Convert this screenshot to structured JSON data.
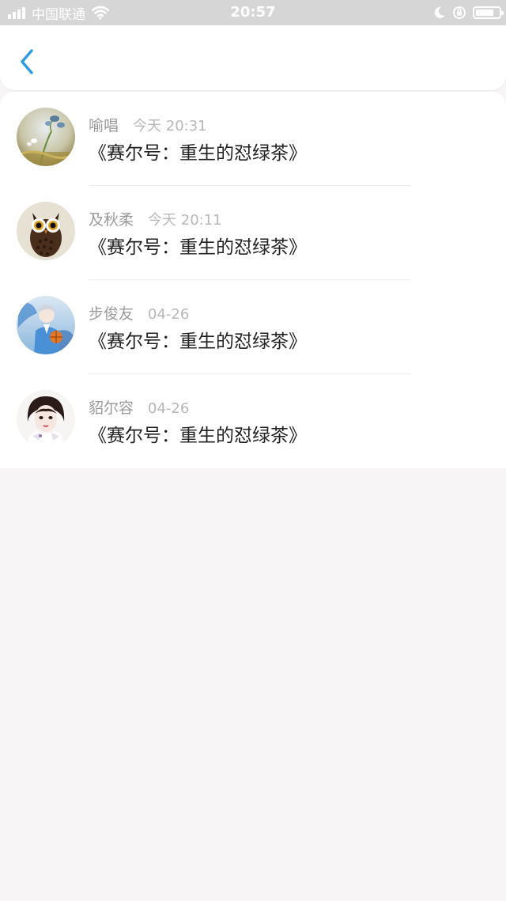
{
  "status_bar": {
    "carrier": "中国联通",
    "time": "20:57",
    "battery_level": 0.8
  },
  "nav": {
    "back_icon": "chevron-left-icon",
    "accent_color": "#2b9be4"
  },
  "messages": [
    {
      "name": "喻唱",
      "time": "今天 20:31",
      "text": "《赛尔号：重生的怼绿茶》",
      "avatar": "flower-avatar"
    },
    {
      "name": "及秋柔",
      "time": "今天 20:11",
      "text": "《赛尔号：重生的怼绿茶》",
      "avatar": "owl-avatar"
    },
    {
      "name": "步俊友",
      "time": "04-26",
      "text": "《赛尔号：重生的怼绿茶》",
      "avatar": "anime-boy-avatar"
    },
    {
      "name": "貂尔容",
      "time": "04-26",
      "text": "《赛尔号：重生的怼绿茶》",
      "avatar": "girl-avatar"
    }
  ]
}
